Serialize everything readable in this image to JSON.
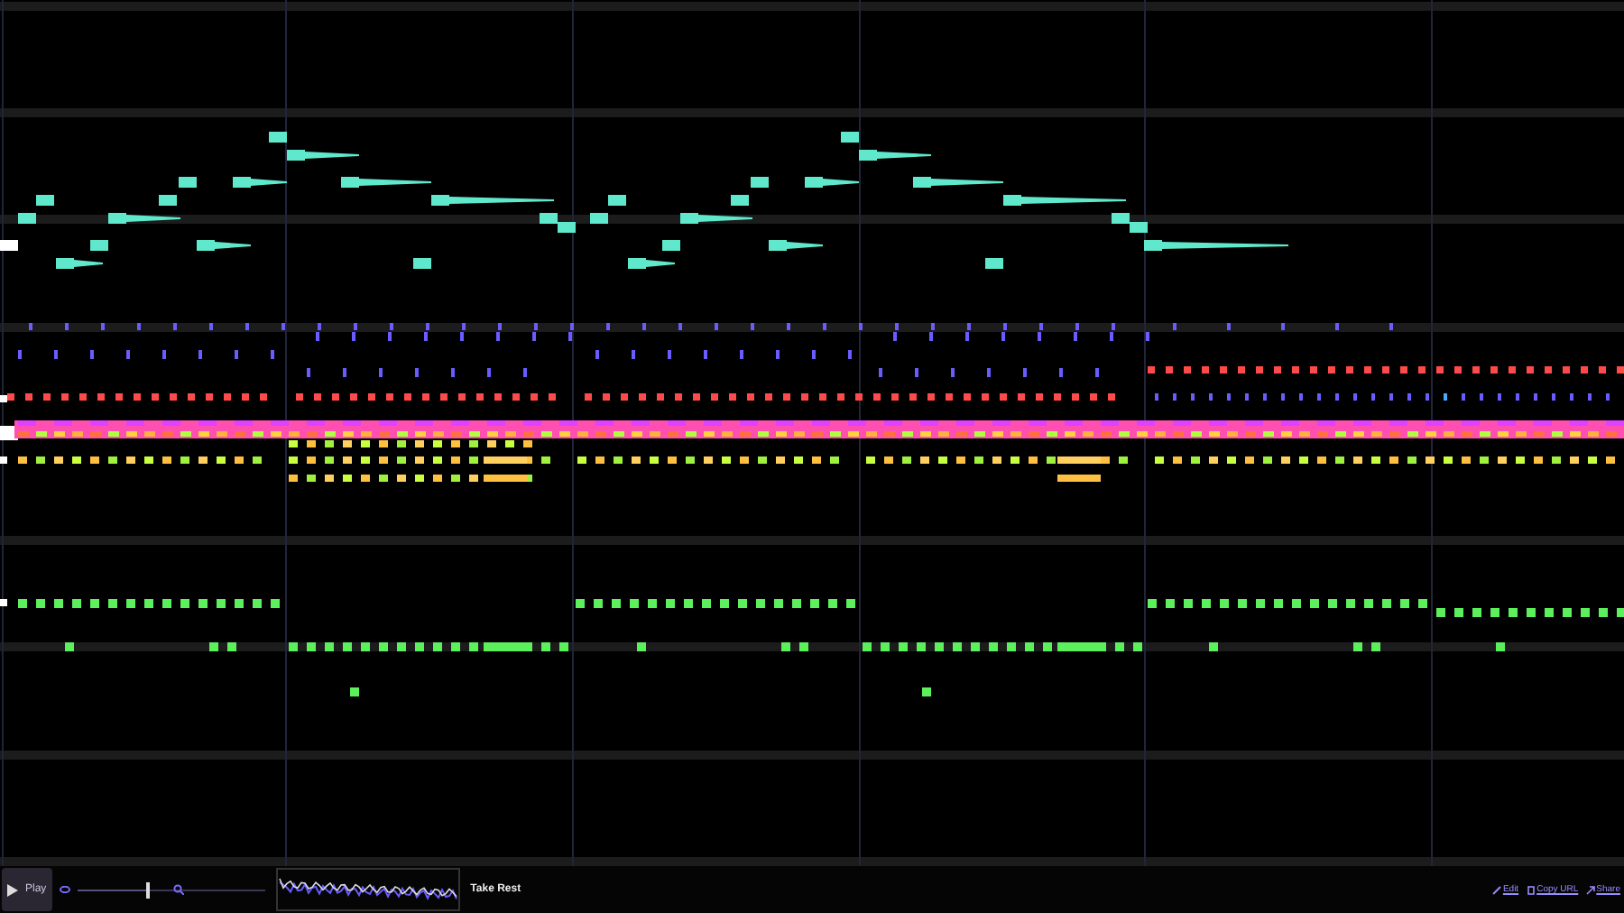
{
  "player": {
    "play_label": "Play",
    "tempo": {
      "level": 0.38
    },
    "take_label": "Take Rest"
  },
  "links": [
    {
      "kind": "edit",
      "label": "Edit"
    },
    {
      "kind": "copy",
      "label": "Copy URL"
    },
    {
      "kind": "share",
      "label": "Share"
    }
  ]
}
